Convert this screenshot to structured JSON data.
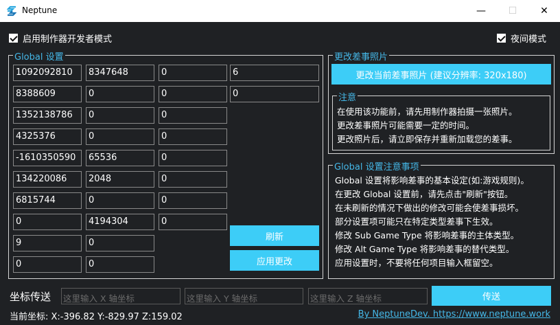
{
  "window": {
    "title": "Neptune",
    "minimize_glyph": "—",
    "maximize_glyph": "☐",
    "close_glyph": "✕"
  },
  "dev_mode": {
    "label": "启用制作器开发者模式",
    "checked": true
  },
  "night_mode": {
    "label": "夜间模式",
    "checked": true
  },
  "global_settings": {
    "legend": "Global 设置",
    "rows": [
      [
        "1092092810",
        "8347648",
        "0",
        "6"
      ],
      [
        "8388609",
        "0",
        "0",
        "0"
      ],
      [
        "1352138786",
        "0",
        "0"
      ],
      [
        "4325376",
        "0",
        "0"
      ],
      [
        "-1610350590",
        "65536",
        "0"
      ],
      [
        "134220086",
        "2048",
        "0"
      ],
      [
        "6815744",
        "0",
        "0"
      ],
      [
        "0",
        "4194304",
        "0"
      ],
      [
        "9",
        "0"
      ],
      [
        "0",
        "0"
      ]
    ],
    "refresh_label": "刷新",
    "apply_label": "应用更改"
  },
  "photo": {
    "legend": "更改差事照片",
    "button_label": "更改当前差事照片 (建议分辨率: 320x180)",
    "notes_legend": "注意",
    "notes": [
      "在使用该功能前，请先用制作器拍摄一张照片。",
      "更改差事照片可能需要一定的时间。",
      "更改照片后，请立即保存并重新加载您的差事。"
    ]
  },
  "global_notes": {
    "legend": "Global 设置注意事项",
    "lines": [
      "Global 设置将影响差事的基本设定(如:游戏规则)。",
      "在更改 Global 设置前，请先点击\"刷新\"按钮。",
      "在未刷新的情况下做出的修改可能会使差事损坏。",
      "部分设置项可能只在特定类型差事下生效。",
      "修改 Sub Game Type 将影响差事的主体类型。",
      "修改 Alt Game Type 将影响差事的替代类型。",
      "应用设置时，不要将任何项目输入框留空。"
    ]
  },
  "teleport": {
    "label": "坐标传送",
    "x_placeholder": "这里输入 X 轴坐标",
    "y_placeholder": "这里输入 Y 轴坐标",
    "z_placeholder": "这里输入 Z 轴坐标",
    "button_label": "传送"
  },
  "current_coords": "当前坐标:  X:-396.82 Y:-829.97 Z:159.02",
  "footer_link": "By NeptuneDev. https://www.neptune.work",
  "colors": {
    "accent": "#3dcdf7",
    "legend_text": "#45b8e8",
    "background": "#1f2124"
  }
}
